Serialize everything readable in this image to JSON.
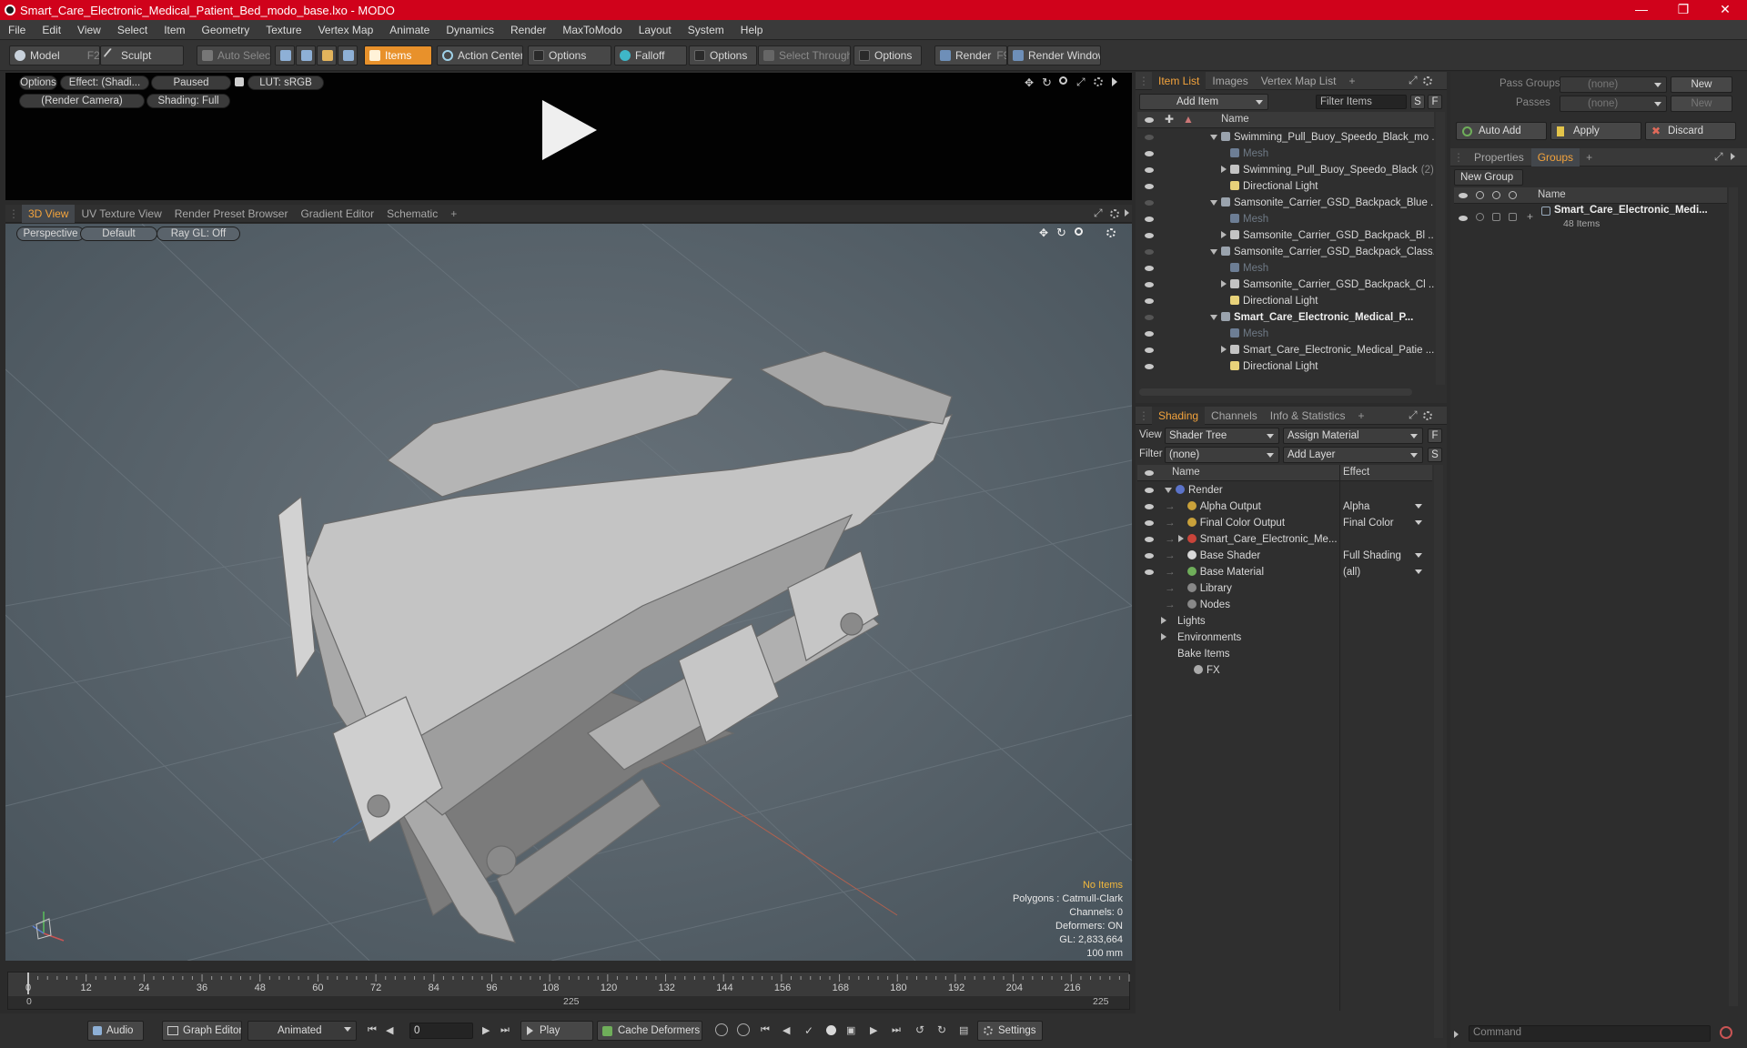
{
  "titlebar": {
    "title": "Smart_Care_Electronic_Medical_Patient_Bed_modo_base.lxo - MODO"
  },
  "menubar": [
    "File",
    "Edit",
    "View",
    "Select",
    "Item",
    "Geometry",
    "Texture",
    "Vertex Map",
    "Animate",
    "Dynamics",
    "Render",
    "MaxToModo",
    "Layout",
    "System",
    "Help"
  ],
  "toolbar": {
    "model": "Model",
    "model_key": "F2",
    "sculpt": "Sculpt",
    "auto_select": "Auto Select",
    "items": "Items",
    "action_center": "Action Center",
    "options1": "Options",
    "falloff": "Falloff",
    "options2": "Options",
    "select_through": "Select Through",
    "options3": "Options",
    "render": "Render",
    "render_key": "F9",
    "render_window": "Render Window"
  },
  "preview": {
    "options": "Options",
    "effect": "Effect: (Shadi...",
    "paused": "Paused",
    "lut": "LUT: sRGB",
    "camera": "(Render Camera)",
    "shading": "Shading: Full"
  },
  "viewport_tabs": [
    "3D View",
    "UV Texture View",
    "Render Preset Browser",
    "Gradient Editor",
    "Schematic"
  ],
  "viewport": {
    "perspective": "Perspective",
    "default": "Default",
    "raygl": "Ray GL: Off",
    "info": {
      "no_items": "No Items",
      "polygons": "Polygons : Catmull-Clark",
      "channels": "Channels: 0",
      "deformers": "Deformers: ON",
      "gl": "GL: 2,833,664",
      "scale": "100 mm"
    }
  },
  "timeline": {
    "ticks": [
      "0",
      "12",
      "24",
      "36",
      "48",
      "60",
      "72",
      "84",
      "96",
      "108",
      "120",
      "132",
      "144",
      "156",
      "168",
      "180",
      "192",
      "204",
      "216"
    ],
    "sub_left": "0",
    "sub_mid": "225",
    "sub_right": "225"
  },
  "bottombar": {
    "audio": "Audio",
    "graph_editor": "Graph Editor",
    "animated": "Animated",
    "frame": "0",
    "play": "Play",
    "cache_deformers": "Cache Deformers",
    "settings": "Settings"
  },
  "itemlist": {
    "tabs": [
      "Item List",
      "Images",
      "Vertex Map List"
    ],
    "add_item": "Add Item",
    "filter_items": "Filter Items",
    "s": "S",
    "f": "F",
    "col_name": "Name",
    "rows": [
      {
        "label": "Swimming_Pull_Buoy_Speedo_Black_mo ...",
        "indent": 1,
        "kind": "scene",
        "bold": false
      },
      {
        "label": "Mesh",
        "indent": 2,
        "kind": "mesh",
        "bold": false
      },
      {
        "label": "Swimming_Pull_Buoy_Speedo_Black",
        "suffix": "(2)",
        "indent": 2,
        "kind": "group",
        "bold": false
      },
      {
        "label": "Directional Light",
        "indent": 2,
        "kind": "light",
        "bold": false
      },
      {
        "label": "Samsonite_Carrier_GSD_Backpack_Blue ...",
        "indent": 1,
        "kind": "scene",
        "bold": false
      },
      {
        "label": "Mesh",
        "indent": 2,
        "kind": "mesh",
        "bold": false
      },
      {
        "label": "Samsonite_Carrier_GSD_Backpack_Bl ...",
        "indent": 2,
        "kind": "group",
        "bold": false
      },
      {
        "label": "Samsonite_Carrier_GSD_Backpack_Class...",
        "indent": 1,
        "kind": "scene",
        "bold": false
      },
      {
        "label": "Mesh",
        "indent": 2,
        "kind": "mesh",
        "bold": false
      },
      {
        "label": "Samsonite_Carrier_GSD_Backpack_Cl ...",
        "indent": 2,
        "kind": "group",
        "bold": false
      },
      {
        "label": "Directional Light",
        "indent": 2,
        "kind": "light",
        "bold": false
      },
      {
        "label": "Smart_Care_Electronic_Medical_P...",
        "indent": 1,
        "kind": "scene",
        "bold": true
      },
      {
        "label": "Mesh",
        "indent": 2,
        "kind": "mesh",
        "bold": false
      },
      {
        "label": "Smart_Care_Electronic_Medical_Patie ...",
        "indent": 2,
        "kind": "group",
        "bold": false
      },
      {
        "label": "Directional Light",
        "indent": 2,
        "kind": "light",
        "bold": false
      }
    ]
  },
  "shading": {
    "tabs": [
      "Shading",
      "Channels",
      "Info & Statistics"
    ],
    "view_label": "View",
    "view_value": "Shader Tree",
    "assign_material": "Assign Material",
    "filter_label": "Filter",
    "filter_value": "(none)",
    "add_layer": "Add Layer",
    "f": "F",
    "s": "S",
    "col_name": "Name",
    "col_effect": "Effect",
    "rows": [
      {
        "label": "Render",
        "effect": "",
        "indent": 1,
        "color": "#5b73c9"
      },
      {
        "label": "Alpha Output",
        "effect": "Alpha",
        "indent": 2,
        "color": "#c9a13a"
      },
      {
        "label": "Final Color Output",
        "effect": "Final Color",
        "indent": 2,
        "color": "#c9a13a"
      },
      {
        "label": "Smart_Care_Electronic_Me...",
        "effect": "",
        "indent": 2,
        "color": "#c9443a"
      },
      {
        "label": "Base Shader",
        "effect": "Full Shading",
        "indent": 2,
        "color": "#d8d8d8"
      },
      {
        "label": "Base Material",
        "effect": "(all)",
        "indent": 2,
        "color": "#6fae5a"
      },
      {
        "label": "Library",
        "effect": "",
        "indent": 2,
        "color": "#888"
      },
      {
        "label": "Nodes",
        "effect": "",
        "indent": 2,
        "color": "#888"
      },
      {
        "label": "Lights",
        "effect": "",
        "indent": 0,
        "color": ""
      },
      {
        "label": "Environments",
        "effect": "",
        "indent": 0,
        "color": ""
      },
      {
        "label": "Bake Items",
        "effect": "",
        "indent": 0,
        "color": ""
      },
      {
        "label": "FX",
        "effect": "",
        "indent": 1,
        "color": "#aaa"
      }
    ]
  },
  "groups_panel": {
    "pass_groups": "Pass Groups",
    "pass_value": "(none)",
    "new": "New",
    "passes": "Passes",
    "passes_value": "(none)",
    "new2": "New",
    "auto_add": "Auto Add",
    "apply": "Apply",
    "discard": "Discard",
    "tabs": [
      "Properties",
      "Groups"
    ],
    "new_group": "New Group",
    "col_name": "Name",
    "group_name": "Smart_Care_Electronic_Medi...",
    "group_count": "48 Items"
  },
  "command": {
    "placeholder": "Command"
  }
}
